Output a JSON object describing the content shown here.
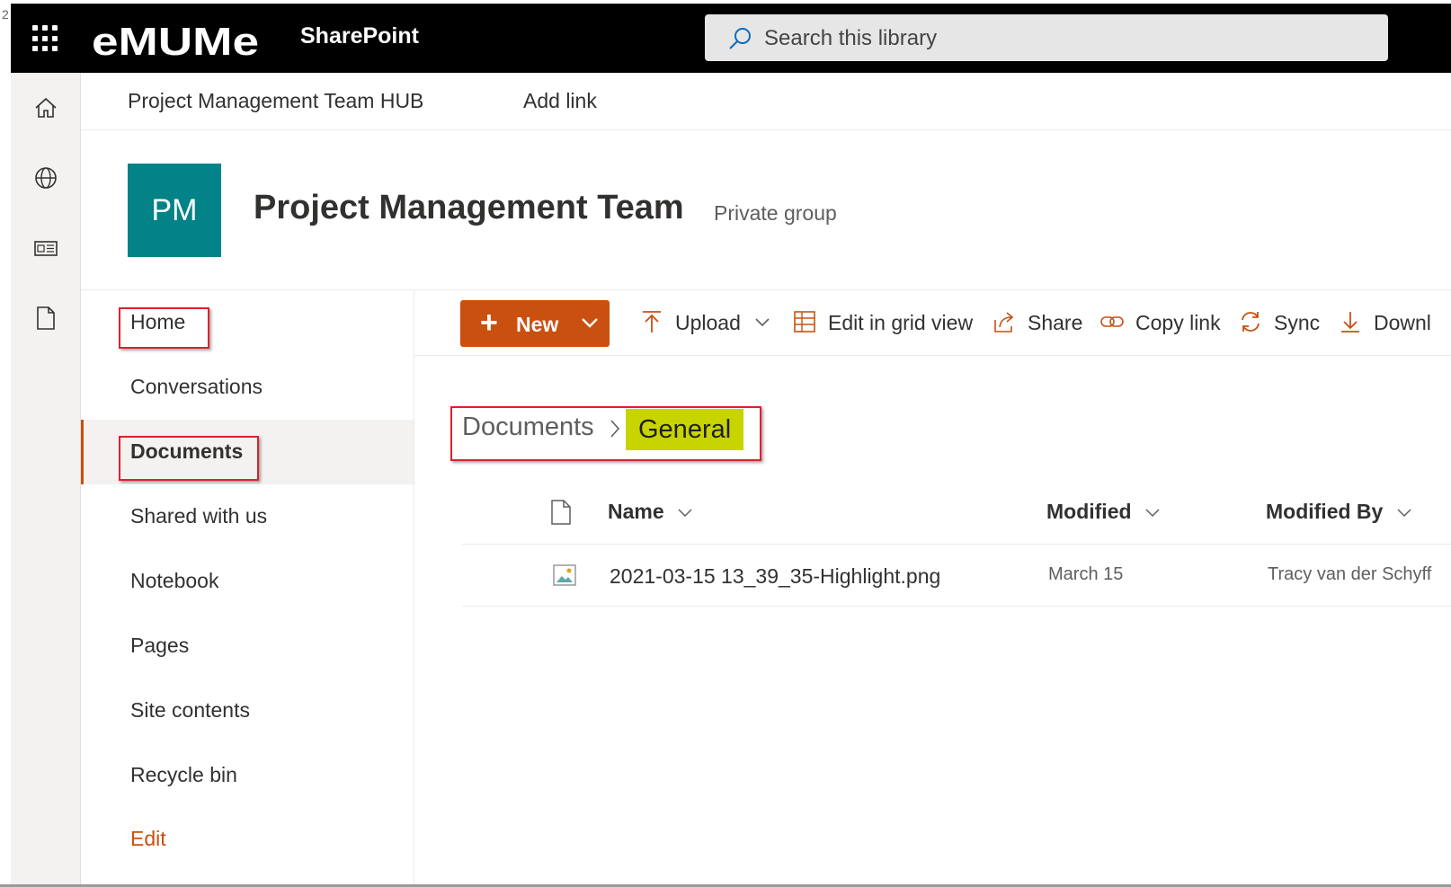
{
  "stray_text": "2",
  "suite": {
    "logo_text": "eMUMe",
    "product_name": "SharePoint",
    "search_placeholder": "Search this library"
  },
  "rail_icons": [
    "home-icon",
    "globe-icon",
    "news-icon",
    "document-icon"
  ],
  "hub": {
    "title": "Project Management Team HUB",
    "add_link": "Add link"
  },
  "site": {
    "initials": "PM",
    "logo_color": "#038387",
    "title": "Project Management Team",
    "type": "Private group"
  },
  "nav": {
    "items": [
      {
        "label": "Home",
        "selected": false,
        "highlighted": true
      },
      {
        "label": "Conversations",
        "selected": false,
        "highlighted": false
      },
      {
        "label": "Documents",
        "selected": true,
        "highlighted": true
      },
      {
        "label": "Shared with us",
        "selected": false,
        "highlighted": false
      },
      {
        "label": "Notebook",
        "selected": false,
        "highlighted": false
      },
      {
        "label": "Pages",
        "selected": false,
        "highlighted": false
      },
      {
        "label": "Site contents",
        "selected": false,
        "highlighted": false
      },
      {
        "label": "Recycle bin",
        "selected": false,
        "highlighted": false
      },
      {
        "label": "Edit",
        "selected": false,
        "highlighted": false
      }
    ]
  },
  "commands": {
    "new": "New",
    "upload": "Upload",
    "edit_grid": "Edit in grid view",
    "share": "Share",
    "copy_link": "Copy link",
    "sync": "Sync",
    "download": "Downl"
  },
  "breadcrumb": {
    "root": "Documents",
    "current": "General",
    "current_highlight_color": "#c8d400"
  },
  "list": {
    "columns": {
      "name": "Name",
      "modified": "Modified",
      "modified_by": "Modified By"
    },
    "rows": [
      {
        "name": "2021-03-15 13_39_35-Highlight.png",
        "modified": "March 15",
        "modified_by": "Tracy van der Schyff",
        "icon": "image-file-icon"
      }
    ]
  },
  "colors": {
    "suite_bar": "#000000",
    "accent": "#ca5010",
    "annotation": "#e0202a"
  }
}
